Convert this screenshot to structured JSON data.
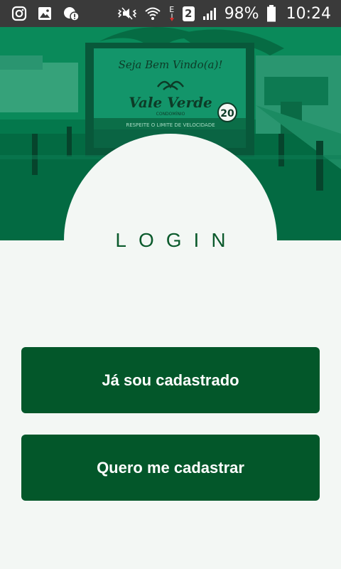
{
  "status_bar": {
    "left_icons": [
      "instagram-icon",
      "gallery-icon",
      "alert-bubble-icon"
    ],
    "right_icons": [
      "vibrate-icon",
      "wifi-icon",
      "data-e-icon",
      "sim-2-icon",
      "signal-icon",
      "battery-icon"
    ],
    "sim_label": "2",
    "data_label": "E",
    "battery_percent": "98%",
    "battery_level": 0.98,
    "time": "10:24"
  },
  "hero": {
    "sign_welcome": "Seja Bem Vindo(a)!",
    "sign_brand": "Vale Verde",
    "sign_sub": "CONDOMÍNIO",
    "sign_speed": "20",
    "sign_notice": "RESPEITE O LIMITE DE VELOCIDADE"
  },
  "login": {
    "title": "LOGIN"
  },
  "actions": {
    "login_label": "Já sou cadastrado",
    "register_label": "Quero me cadastrar"
  },
  "colors": {
    "primary": "#03572A",
    "hero_tint": "#00744A",
    "background": "#F3F7F4",
    "status_bar": "#3A3A3A"
  }
}
